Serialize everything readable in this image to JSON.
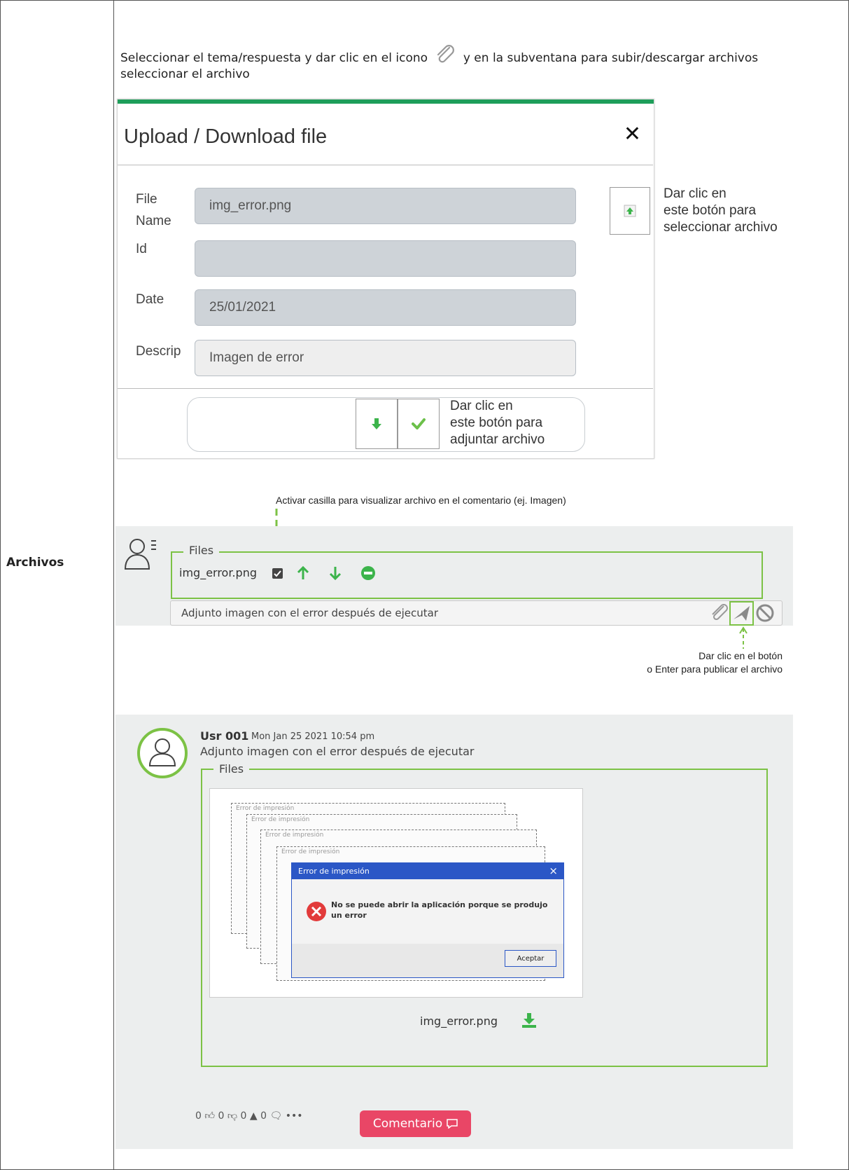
{
  "row_label": "Archivos",
  "intro": {
    "before_icon": "Seleccionar el tema/respuesta y dar clic en el icono",
    "after_icon": "y en la subventana para subir/descargar archivos seleccionar el archivo",
    "icon": "paperclip-icon"
  },
  "dialog": {
    "title": "Upload / Download file",
    "close": "✕",
    "fields": {
      "file_name_label_1": "File",
      "file_name_label_2": "Name",
      "file_name_value": "img_error.png",
      "id_label": "Id",
      "id_value": "",
      "date_label": "Date",
      "date_value": "25/01/2021",
      "desc_label": "Descrip",
      "desc_value": "Imagen de error"
    },
    "annot_select": [
      "Dar clic en",
      "este botón para",
      "seleccionar archivo"
    ],
    "annot_attach": [
      "Dar clic en",
      "este botón para",
      "adjuntar archivo"
    ]
  },
  "composer": {
    "annot_checkbox": "Activar casilla para visualizar archivo en el comentario (ej. Imagen)",
    "files_legend": "Files",
    "file_name": "img_error.png",
    "input_text": "Adjunto imagen con el error después de ejecutar",
    "annot_publish_1": "Dar clic en el botón",
    "annot_publish_2": "o Enter para publicar el archivo"
  },
  "post": {
    "user": "Usr 001",
    "date": "Mon Jan 25 2021 10:54 pm",
    "text": "Adjunto imagen con el error después de ejecutar",
    "files_legend": "Files",
    "file_name": "img_error.png",
    "error_window": {
      "back_title": "Error de impresión",
      "title": "Error de impresión",
      "message_1": "No se puede abrir la aplicación porque se produjo",
      "message_2": "un error",
      "ok": "Aceptar"
    },
    "stats": {
      "likes": "0",
      "dislikes": "0",
      "alerts": "0",
      "comments": "0",
      "more": "•••"
    },
    "comment_button": "Comentario"
  },
  "colors": {
    "green_accent": "#7cc245",
    "dialog_bar": "#1e9e5a",
    "comment_button": "#e94666",
    "error_title_bar": "#2b57c6"
  }
}
